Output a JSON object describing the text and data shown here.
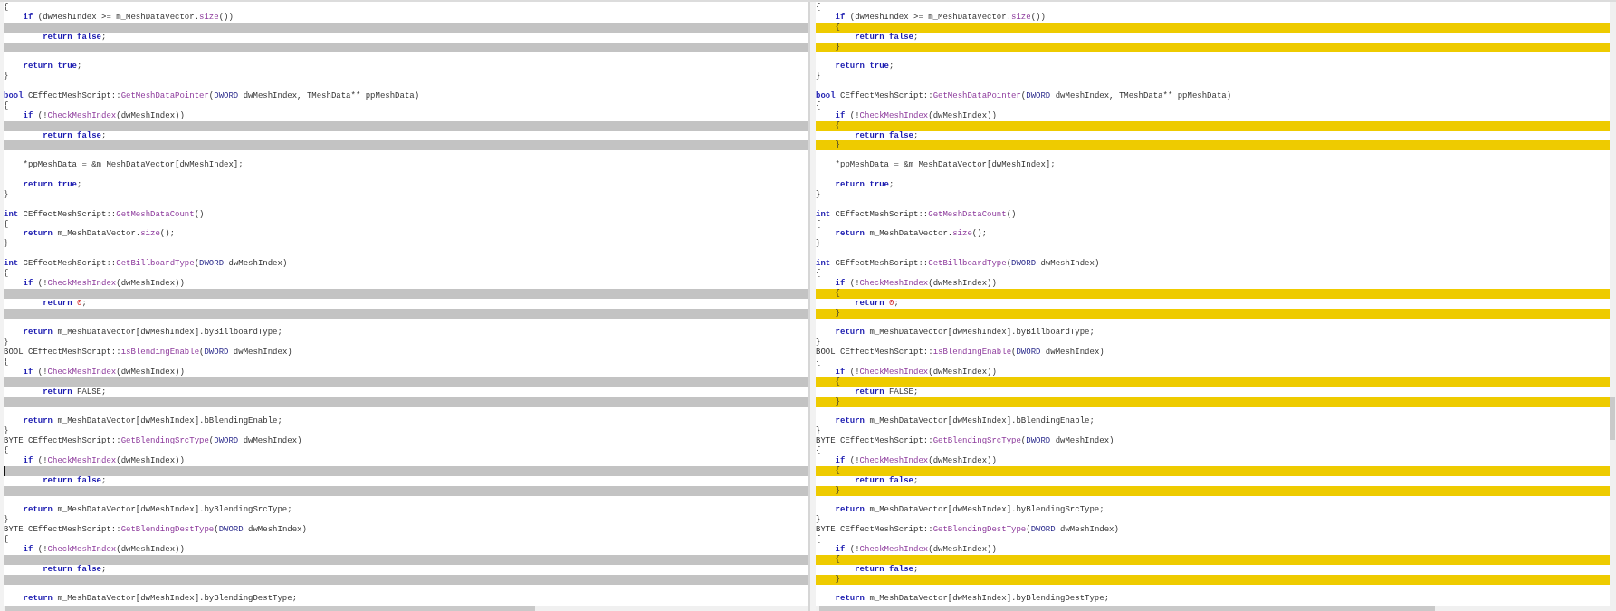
{
  "panes": [
    {
      "kind": "left",
      "lines": [
        {
          "kind": "line",
          "tokens": [
            {
              "kind": "plain",
              "text": "{"
            }
          ]
        },
        {
          "kind": "body",
          "tokens": [
            {
              "kind": "kw",
              "text": "if"
            },
            {
              "kind": "plain",
              "text": " (dwMeshIndex >= m_MeshDataVector."
            },
            {
              "kind": "fn",
              "text": "size"
            },
            {
              "kind": "plain",
              "text": "())"
            }
          ]
        },
        {
          "kind": "gap"
        },
        {
          "kind": "deep",
          "tokens": [
            {
              "kind": "kw",
              "text": "return false"
            },
            {
              "kind": "plain",
              "text": ";"
            }
          ]
        },
        {
          "kind": "gap"
        },
        {
          "kind": "blank"
        },
        {
          "kind": "body",
          "tokens": [
            {
              "kind": "kw",
              "text": "return true"
            },
            {
              "kind": "plain",
              "text": ";"
            }
          ]
        },
        {
          "kind": "line",
          "tokens": [
            {
              "kind": "plain",
              "text": "}"
            }
          ]
        },
        {
          "kind": "blank"
        },
        {
          "kind": "line",
          "tokens": [
            {
              "kind": "kw",
              "text": "bool"
            },
            {
              "kind": "plain",
              "text": " CEffectMeshScript::"
            },
            {
              "kind": "fn",
              "text": "GetMeshDataPointer"
            },
            {
              "kind": "plain",
              "text": "("
            },
            {
              "kind": "ty",
              "text": "DWORD"
            },
            {
              "kind": "plain",
              "text": " dwMeshIndex, TMeshData** ppMeshData)"
            }
          ]
        },
        {
          "kind": "line",
          "tokens": [
            {
              "kind": "plain",
              "text": "{"
            }
          ]
        },
        {
          "kind": "body",
          "tokens": [
            {
              "kind": "kw",
              "text": "if"
            },
            {
              "kind": "plain",
              "text": " (!"
            },
            {
              "kind": "fn",
              "text": "CheckMeshIndex"
            },
            {
              "kind": "plain",
              "text": "(dwMeshIndex))"
            }
          ]
        },
        {
          "kind": "gap"
        },
        {
          "kind": "deep",
          "tokens": [
            {
              "kind": "kw",
              "text": "return false"
            },
            {
              "kind": "plain",
              "text": ";"
            }
          ]
        },
        {
          "kind": "gap"
        },
        {
          "kind": "blank"
        },
        {
          "kind": "body",
          "tokens": [
            {
              "kind": "plain",
              "text": "*ppMeshData = &m_MeshDataVector[dwMeshIndex];"
            }
          ]
        },
        {
          "kind": "blank"
        },
        {
          "kind": "body",
          "tokens": [
            {
              "kind": "kw",
              "text": "return true"
            },
            {
              "kind": "plain",
              "text": ";"
            }
          ]
        },
        {
          "kind": "line",
          "tokens": [
            {
              "kind": "plain",
              "text": "}"
            }
          ]
        },
        {
          "kind": "blank"
        },
        {
          "kind": "line",
          "tokens": [
            {
              "kind": "kw",
              "text": "int"
            },
            {
              "kind": "plain",
              "text": " CEffectMeshScript::"
            },
            {
              "kind": "fn",
              "text": "GetMeshDataCount"
            },
            {
              "kind": "plain",
              "text": "()"
            }
          ]
        },
        {
          "kind": "line",
          "tokens": [
            {
              "kind": "plain",
              "text": "{"
            }
          ]
        },
        {
          "kind": "body",
          "tokens": [
            {
              "kind": "kw",
              "text": "return"
            },
            {
              "kind": "plain",
              "text": " m_MeshDataVector."
            },
            {
              "kind": "fn",
              "text": "size"
            },
            {
              "kind": "plain",
              "text": "();"
            }
          ]
        },
        {
          "kind": "line",
          "tokens": [
            {
              "kind": "plain",
              "text": "}"
            }
          ]
        },
        {
          "kind": "blank"
        },
        {
          "kind": "line",
          "tokens": [
            {
              "kind": "kw",
              "text": "int"
            },
            {
              "kind": "plain",
              "text": " CEffectMeshScript::"
            },
            {
              "kind": "fn",
              "text": "GetBillboardType"
            },
            {
              "kind": "plain",
              "text": "("
            },
            {
              "kind": "ty",
              "text": "DWORD"
            },
            {
              "kind": "plain",
              "text": " dwMeshIndex)"
            }
          ]
        },
        {
          "kind": "line",
          "tokens": [
            {
              "kind": "plain",
              "text": "{"
            }
          ]
        },
        {
          "kind": "body",
          "tokens": [
            {
              "kind": "kw",
              "text": "if"
            },
            {
              "kind": "plain",
              "text": " (!"
            },
            {
              "kind": "fn",
              "text": "CheckMeshIndex"
            },
            {
              "kind": "plain",
              "text": "(dwMeshIndex))"
            }
          ]
        },
        {
          "kind": "gap"
        },
        {
          "kind": "deep",
          "tokens": [
            {
              "kind": "kw",
              "text": "return "
            },
            {
              "kind": "num",
              "text": "0"
            },
            {
              "kind": "plain",
              "text": ";"
            }
          ]
        },
        {
          "kind": "gap"
        },
        {
          "kind": "blank"
        },
        {
          "kind": "body",
          "tokens": [
            {
              "kind": "kw",
              "text": "return"
            },
            {
              "kind": "plain",
              "text": " m_MeshDataVector[dwMeshIndex].byBillboardType;"
            }
          ]
        },
        {
          "kind": "line",
          "tokens": [
            {
              "kind": "plain",
              "text": "}"
            }
          ]
        },
        {
          "kind": "line",
          "tokens": [
            {
              "kind": "plain",
              "text": "BOOL CEffectMeshScript::"
            },
            {
              "kind": "fn",
              "text": "isBlendingEnable"
            },
            {
              "kind": "plain",
              "text": "("
            },
            {
              "kind": "ty",
              "text": "DWORD"
            },
            {
              "kind": "plain",
              "text": " dwMeshIndex)"
            }
          ]
        },
        {
          "kind": "line",
          "tokens": [
            {
              "kind": "plain",
              "text": "{"
            }
          ]
        },
        {
          "kind": "body",
          "tokens": [
            {
              "kind": "kw",
              "text": "if"
            },
            {
              "kind": "plain",
              "text": " (!"
            },
            {
              "kind": "fn",
              "text": "CheckMeshIndex"
            },
            {
              "kind": "plain",
              "text": "(dwMeshIndex))"
            }
          ]
        },
        {
          "kind": "gap"
        },
        {
          "kind": "deep",
          "tokens": [
            {
              "kind": "kw",
              "text": "return"
            },
            {
              "kind": "plain",
              "text": " FALSE;"
            }
          ]
        },
        {
          "kind": "gap"
        },
        {
          "kind": "blank"
        },
        {
          "kind": "body",
          "tokens": [
            {
              "kind": "kw",
              "text": "return"
            },
            {
              "kind": "plain",
              "text": " m_MeshDataVector[dwMeshIndex].bBlendingEnable;"
            }
          ]
        },
        {
          "kind": "line",
          "tokens": [
            {
              "kind": "plain",
              "text": "}"
            }
          ]
        },
        {
          "kind": "line",
          "tokens": [
            {
              "kind": "plain",
              "text": "BYTE CEffectMeshScript::"
            },
            {
              "kind": "fn",
              "text": "GetBlendingSrcType"
            },
            {
              "kind": "plain",
              "text": "("
            },
            {
              "kind": "ty",
              "text": "DWORD"
            },
            {
              "kind": "plain",
              "text": " dwMeshIndex)"
            }
          ]
        },
        {
          "kind": "line",
          "tokens": [
            {
              "kind": "plain",
              "text": "{"
            }
          ]
        },
        {
          "kind": "body",
          "tokens": [
            {
              "kind": "kw",
              "text": "if"
            },
            {
              "kind": "plain",
              "text": " (!"
            },
            {
              "kind": "fn",
              "text": "CheckMeshIndex"
            },
            {
              "kind": "plain",
              "text": "(dwMeshIndex))"
            }
          ]
        },
        {
          "kind": "gap",
          "caret": true
        },
        {
          "kind": "deep",
          "tokens": [
            {
              "kind": "kw",
              "text": "return false"
            },
            {
              "kind": "plain",
              "text": ";"
            }
          ]
        },
        {
          "kind": "gap"
        },
        {
          "kind": "blank"
        },
        {
          "kind": "body",
          "tokens": [
            {
              "kind": "kw",
              "text": "return"
            },
            {
              "kind": "plain",
              "text": " m_MeshDataVector[dwMeshIndex].byBlendingSrcType;"
            }
          ]
        },
        {
          "kind": "line",
          "tokens": [
            {
              "kind": "plain",
              "text": "}"
            }
          ]
        },
        {
          "kind": "line",
          "tokens": [
            {
              "kind": "plain",
              "text": "BYTE CEffectMeshScript::"
            },
            {
              "kind": "fn",
              "text": "GetBlendingDestType"
            },
            {
              "kind": "plain",
              "text": "("
            },
            {
              "kind": "ty",
              "text": "DWORD"
            },
            {
              "kind": "plain",
              "text": " dwMeshIndex)"
            }
          ]
        },
        {
          "kind": "line",
          "tokens": [
            {
              "kind": "plain",
              "text": "{"
            }
          ]
        },
        {
          "kind": "body",
          "tokens": [
            {
              "kind": "kw",
              "text": "if"
            },
            {
              "kind": "plain",
              "text": " (!"
            },
            {
              "kind": "fn",
              "text": "CheckMeshIndex"
            },
            {
              "kind": "plain",
              "text": "(dwMeshIndex))"
            }
          ]
        },
        {
          "kind": "gap"
        },
        {
          "kind": "deep",
          "tokens": [
            {
              "kind": "kw",
              "text": "return false"
            },
            {
              "kind": "plain",
              "text": ";"
            }
          ]
        },
        {
          "kind": "gap"
        },
        {
          "kind": "blank"
        },
        {
          "kind": "body",
          "tokens": [
            {
              "kind": "kw",
              "text": "return"
            },
            {
              "kind": "plain",
              "text": " m_MeshDataVector[dwMeshIndex].byBlendingDestType;"
            }
          ]
        }
      ]
    },
    {
      "kind": "right",
      "lines": [
        {
          "kind": "line",
          "tokens": [
            {
              "kind": "plain",
              "text": "{"
            }
          ]
        },
        {
          "kind": "body",
          "tokens": [
            {
              "kind": "kw",
              "text": "if"
            },
            {
              "kind": "plain",
              "text": " (dwMeshIndex >= m_MeshDataVector."
            },
            {
              "kind": "fn",
              "text": "size"
            },
            {
              "kind": "plain",
              "text": "())"
            }
          ]
        },
        {
          "kind": "added",
          "tokens": [
            {
              "kind": "plain",
              "text": "{"
            }
          ]
        },
        {
          "kind": "deep",
          "tokens": [
            {
              "kind": "kw",
              "text": "return false"
            },
            {
              "kind": "plain",
              "text": ";"
            }
          ]
        },
        {
          "kind": "added",
          "tokens": [
            {
              "kind": "plain",
              "text": "}"
            }
          ]
        },
        {
          "kind": "blank"
        },
        {
          "kind": "body",
          "tokens": [
            {
              "kind": "kw",
              "text": "return true"
            },
            {
              "kind": "plain",
              "text": ";"
            }
          ]
        },
        {
          "kind": "line",
          "tokens": [
            {
              "kind": "plain",
              "text": "}"
            }
          ]
        },
        {
          "kind": "blank"
        },
        {
          "kind": "line",
          "tokens": [
            {
              "kind": "kw",
              "text": "bool"
            },
            {
              "kind": "plain",
              "text": " CEffectMeshScript::"
            },
            {
              "kind": "fn",
              "text": "GetMeshDataPointer"
            },
            {
              "kind": "plain",
              "text": "("
            },
            {
              "kind": "ty",
              "text": "DWORD"
            },
            {
              "kind": "plain",
              "text": " dwMeshIndex, TMeshData** ppMeshData)"
            }
          ]
        },
        {
          "kind": "line",
          "tokens": [
            {
              "kind": "plain",
              "text": "{"
            }
          ]
        },
        {
          "kind": "body",
          "tokens": [
            {
              "kind": "kw",
              "text": "if"
            },
            {
              "kind": "plain",
              "text": " (!"
            },
            {
              "kind": "fn",
              "text": "CheckMeshIndex"
            },
            {
              "kind": "plain",
              "text": "(dwMeshIndex))"
            }
          ]
        },
        {
          "kind": "added",
          "tokens": [
            {
              "kind": "plain",
              "text": "{"
            }
          ]
        },
        {
          "kind": "deep",
          "tokens": [
            {
              "kind": "kw",
              "text": "return false"
            },
            {
              "kind": "plain",
              "text": ";"
            }
          ]
        },
        {
          "kind": "added",
          "tokens": [
            {
              "kind": "plain",
              "text": "}"
            }
          ]
        },
        {
          "kind": "blank"
        },
        {
          "kind": "body",
          "tokens": [
            {
              "kind": "plain",
              "text": "*ppMeshData = &m_MeshDataVector[dwMeshIndex];"
            }
          ]
        },
        {
          "kind": "blank"
        },
        {
          "kind": "body",
          "tokens": [
            {
              "kind": "kw",
              "text": "return true"
            },
            {
              "kind": "plain",
              "text": ";"
            }
          ]
        },
        {
          "kind": "line",
          "tokens": [
            {
              "kind": "plain",
              "text": "}"
            }
          ]
        },
        {
          "kind": "blank"
        },
        {
          "kind": "line",
          "tokens": [
            {
              "kind": "kw",
              "text": "int"
            },
            {
              "kind": "plain",
              "text": " CEffectMeshScript::"
            },
            {
              "kind": "fn",
              "text": "GetMeshDataCount"
            },
            {
              "kind": "plain",
              "text": "()"
            }
          ]
        },
        {
          "kind": "line",
          "tokens": [
            {
              "kind": "plain",
              "text": "{"
            }
          ]
        },
        {
          "kind": "body",
          "tokens": [
            {
              "kind": "kw",
              "text": "return"
            },
            {
              "kind": "plain",
              "text": " m_MeshDataVector."
            },
            {
              "kind": "fn",
              "text": "size"
            },
            {
              "kind": "plain",
              "text": "();"
            }
          ]
        },
        {
          "kind": "line",
          "tokens": [
            {
              "kind": "plain",
              "text": "}"
            }
          ]
        },
        {
          "kind": "blank"
        },
        {
          "kind": "line",
          "tokens": [
            {
              "kind": "kw",
              "text": "int"
            },
            {
              "kind": "plain",
              "text": " CEffectMeshScript::"
            },
            {
              "kind": "fn",
              "text": "GetBillboardType"
            },
            {
              "kind": "plain",
              "text": "("
            },
            {
              "kind": "ty",
              "text": "DWORD"
            },
            {
              "kind": "plain",
              "text": " dwMeshIndex)"
            }
          ]
        },
        {
          "kind": "line",
          "tokens": [
            {
              "kind": "plain",
              "text": "{"
            }
          ]
        },
        {
          "kind": "body",
          "tokens": [
            {
              "kind": "kw",
              "text": "if"
            },
            {
              "kind": "plain",
              "text": " (!"
            },
            {
              "kind": "fn",
              "text": "CheckMeshIndex"
            },
            {
              "kind": "plain",
              "text": "(dwMeshIndex))"
            }
          ]
        },
        {
          "kind": "added",
          "tokens": [
            {
              "kind": "plain",
              "text": "{"
            }
          ]
        },
        {
          "kind": "deep",
          "tokens": [
            {
              "kind": "kw",
              "text": "return "
            },
            {
              "kind": "num",
              "text": "0"
            },
            {
              "kind": "plain",
              "text": ";"
            }
          ]
        },
        {
          "kind": "added",
          "tokens": [
            {
              "kind": "plain",
              "text": "}"
            }
          ]
        },
        {
          "kind": "blank"
        },
        {
          "kind": "body",
          "tokens": [
            {
              "kind": "kw",
              "text": "return"
            },
            {
              "kind": "plain",
              "text": " m_MeshDataVector[dwMeshIndex].byBillboardType;"
            }
          ]
        },
        {
          "kind": "line",
          "tokens": [
            {
              "kind": "plain",
              "text": "}"
            }
          ]
        },
        {
          "kind": "line",
          "tokens": [
            {
              "kind": "plain",
              "text": "BOOL CEffectMeshScript::"
            },
            {
              "kind": "fn",
              "text": "isBlendingEnable"
            },
            {
              "kind": "plain",
              "text": "("
            },
            {
              "kind": "ty",
              "text": "DWORD"
            },
            {
              "kind": "plain",
              "text": " dwMeshIndex)"
            }
          ]
        },
        {
          "kind": "line",
          "tokens": [
            {
              "kind": "plain",
              "text": "{"
            }
          ]
        },
        {
          "kind": "body",
          "tokens": [
            {
              "kind": "kw",
              "text": "if"
            },
            {
              "kind": "plain",
              "text": " (!"
            },
            {
              "kind": "fn",
              "text": "CheckMeshIndex"
            },
            {
              "kind": "plain",
              "text": "(dwMeshIndex))"
            }
          ]
        },
        {
          "kind": "added",
          "tokens": [
            {
              "kind": "plain",
              "text": "{"
            }
          ]
        },
        {
          "kind": "deep",
          "tokens": [
            {
              "kind": "kw",
              "text": "return"
            },
            {
              "kind": "plain",
              "text": " FALSE;"
            }
          ]
        },
        {
          "kind": "added",
          "tokens": [
            {
              "kind": "plain",
              "text": "}"
            }
          ]
        },
        {
          "kind": "blank"
        },
        {
          "kind": "body",
          "tokens": [
            {
              "kind": "kw",
              "text": "return"
            },
            {
              "kind": "plain",
              "text": " m_MeshDataVector[dwMeshIndex].bBlendingEnable;"
            }
          ]
        },
        {
          "kind": "line",
          "tokens": [
            {
              "kind": "plain",
              "text": "}"
            }
          ]
        },
        {
          "kind": "line",
          "tokens": [
            {
              "kind": "plain",
              "text": "BYTE CEffectMeshScript::"
            },
            {
              "kind": "fn",
              "text": "GetBlendingSrcType"
            },
            {
              "kind": "plain",
              "text": "("
            },
            {
              "kind": "ty",
              "text": "DWORD"
            },
            {
              "kind": "plain",
              "text": " dwMeshIndex)"
            }
          ]
        },
        {
          "kind": "line",
          "tokens": [
            {
              "kind": "plain",
              "text": "{"
            }
          ]
        },
        {
          "kind": "body",
          "tokens": [
            {
              "kind": "kw",
              "text": "if"
            },
            {
              "kind": "plain",
              "text": " (!"
            },
            {
              "kind": "fn",
              "text": "CheckMeshIndex"
            },
            {
              "kind": "plain",
              "text": "(dwMeshIndex))"
            }
          ]
        },
        {
          "kind": "added",
          "tokens": [
            {
              "kind": "plain",
              "text": "{"
            }
          ]
        },
        {
          "kind": "deep",
          "tokens": [
            {
              "kind": "kw",
              "text": "return false"
            },
            {
              "kind": "plain",
              "text": ";"
            }
          ]
        },
        {
          "kind": "added",
          "tokens": [
            {
              "kind": "plain",
              "text": "}"
            }
          ]
        },
        {
          "kind": "blank"
        },
        {
          "kind": "body",
          "tokens": [
            {
              "kind": "kw",
              "text": "return"
            },
            {
              "kind": "plain",
              "text": " m_MeshDataVector[dwMeshIndex].byBlendingSrcType;"
            }
          ]
        },
        {
          "kind": "line",
          "tokens": [
            {
              "kind": "plain",
              "text": "}"
            }
          ]
        },
        {
          "kind": "line",
          "tokens": [
            {
              "kind": "plain",
              "text": "BYTE CEffectMeshScript::"
            },
            {
              "kind": "fn",
              "text": "GetBlendingDestType"
            },
            {
              "kind": "plain",
              "text": "("
            },
            {
              "kind": "ty",
              "text": "DWORD"
            },
            {
              "kind": "plain",
              "text": " dwMeshIndex)"
            }
          ]
        },
        {
          "kind": "line",
          "tokens": [
            {
              "kind": "plain",
              "text": "{"
            }
          ]
        },
        {
          "kind": "body",
          "tokens": [
            {
              "kind": "kw",
              "text": "if"
            },
            {
              "kind": "plain",
              "text": " (!"
            },
            {
              "kind": "fn",
              "text": "CheckMeshIndex"
            },
            {
              "kind": "plain",
              "text": "(dwMeshIndex))"
            }
          ]
        },
        {
          "kind": "added",
          "tokens": [
            {
              "kind": "plain",
              "text": "{"
            }
          ]
        },
        {
          "kind": "deep",
          "tokens": [
            {
              "kind": "kw",
              "text": "return false"
            },
            {
              "kind": "plain",
              "text": ";"
            }
          ]
        },
        {
          "kind": "added",
          "tokens": [
            {
              "kind": "plain",
              "text": "}"
            }
          ]
        },
        {
          "kind": "blank"
        },
        {
          "kind": "body",
          "tokens": [
            {
              "kind": "kw",
              "text": "return"
            },
            {
              "kind": "plain",
              "text": " m_MeshDataVector[dwMeshIndex].byBlendingDestType;"
            }
          ]
        }
      ]
    }
  ]
}
